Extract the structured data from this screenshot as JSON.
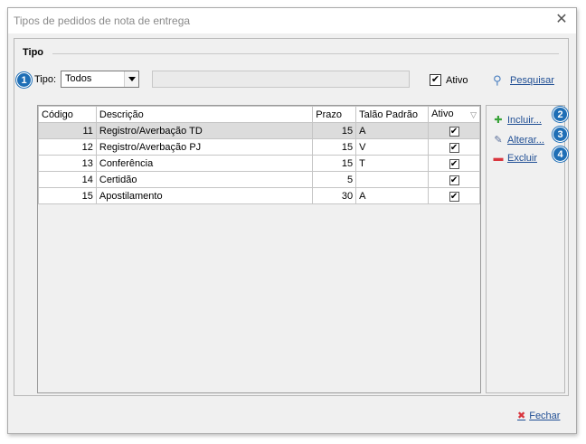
{
  "window": {
    "title": "Tipos de pedidos de nota de entrega"
  },
  "group": {
    "title": "Tipo"
  },
  "filters": {
    "badge1": "1",
    "tipo_label": "Tipo:",
    "tipo_value": "Todos",
    "search_text": "",
    "ativo_label": "Ativo",
    "ativo_checked": "✔",
    "search_button": "Pesquisar"
  },
  "table": {
    "headers": [
      "Código",
      "Descrição",
      "Prazo",
      "Talão Padrão",
      "Ativo"
    ],
    "rows": [
      {
        "codigo": "11",
        "descricao": "Registro/Averbação TD",
        "prazo": "15",
        "talao": "A",
        "ativo": "✔"
      },
      {
        "codigo": "12",
        "descricao": "Registro/Averbação PJ",
        "prazo": "15",
        "talao": "V",
        "ativo": "✔"
      },
      {
        "codigo": "13",
        "descricao": "Conferência",
        "prazo": "15",
        "talao": "T",
        "ativo": "✔"
      },
      {
        "codigo": "14",
        "descricao": "Certidão",
        "prazo": "5",
        "talao": "",
        "ativo": "✔"
      },
      {
        "codigo": "15",
        "descricao": "Apostilamento",
        "prazo": "30",
        "talao": "A",
        "ativo": "✔"
      }
    ]
  },
  "actions": {
    "incluir": "Incluir...",
    "alterar": "Alterar...",
    "excluir": "Excluir",
    "badge2": "2",
    "badge3": "3",
    "badge4": "4"
  },
  "footer": {
    "fechar": "Fechar"
  },
  "colors": {
    "accent": "#1f6fb6",
    "link": "#1f4e94",
    "danger": "#d9363e",
    "add": "#3aa33a"
  },
  "icons": {
    "close": "close-icon",
    "search": "magnifier-icon",
    "add": "plus-icon",
    "edit": "pencil-icon",
    "delete": "minus-icon",
    "fechar": "x-icon",
    "filter": "filter-icon"
  }
}
